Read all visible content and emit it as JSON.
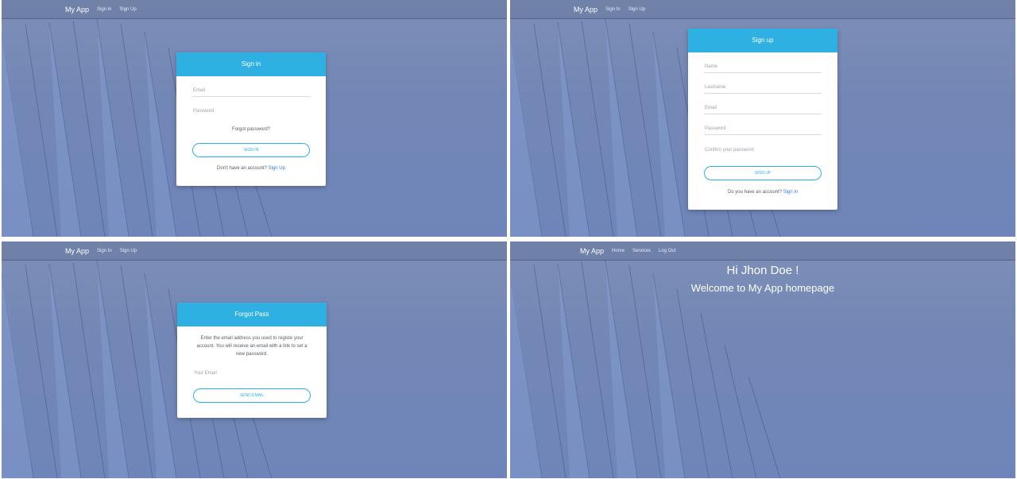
{
  "app": {
    "brand": "My App"
  },
  "panels": {
    "signin": {
      "nav": [
        "Sign in",
        "Sign Up"
      ],
      "card_title": "Sign in",
      "email_placeholder": "Email",
      "password_placeholder": "Password",
      "forgot_link": "Forgot password?",
      "button": "SIGN IN",
      "footer_text": "Don't have an account?",
      "footer_link": "Sign Up"
    },
    "signup": {
      "nav": [
        "Sign In",
        "Sign Up"
      ],
      "card_title": "Sign up",
      "name_placeholder": "Name",
      "lastname_placeholder": "Lastname",
      "email_placeholder": "Email",
      "password_placeholder": "Password",
      "confirm_placeholder": "Confirm your password",
      "button": "SIGN UP",
      "footer_text": "Do you have an account?",
      "footer_link": "Sign in"
    },
    "forgot": {
      "nav": [
        "Sign In",
        "Sign Up"
      ],
      "card_title": "Forgot Pass",
      "description": "Enter the email address you used to registe your account. You will receive an email with a link to set a new password.",
      "email_placeholder": "Your Email",
      "button": "SEND EMAIL"
    },
    "home": {
      "nav": [
        "Home",
        "Services",
        "Log Out"
      ],
      "greeting": "Hi Jhon Doe !",
      "welcome": "Welcome to My App homepage"
    }
  },
  "colors": {
    "accent": "#2fb0e2",
    "link": "#2a7fd8",
    "background": "#7387b6"
  }
}
